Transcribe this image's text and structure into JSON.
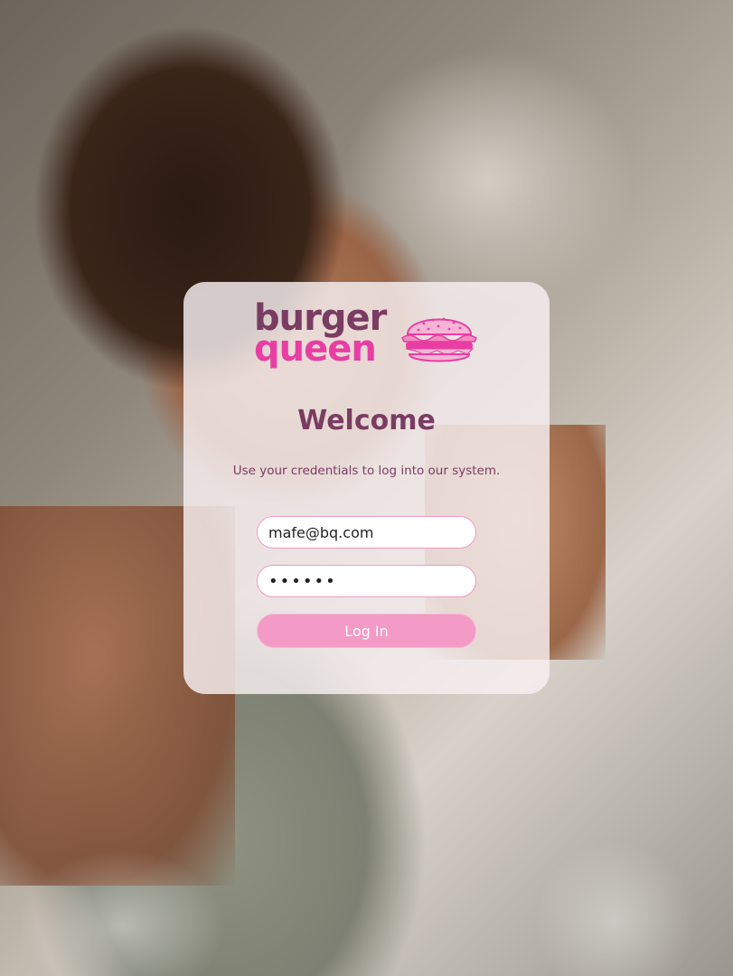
{
  "brand": {
    "line1": "burger",
    "line2": "queen",
    "icon": "burger-icon",
    "colors": {
      "primary": "#7a3c63",
      "accent": "#e83ea3",
      "button": "#f39ac6"
    }
  },
  "login": {
    "title": "Welcome",
    "subtitle": "Use your credentials to log into our system.",
    "email_value": "mafe@bq.com",
    "password_value": "••••••",
    "submit_label": "Log In"
  }
}
